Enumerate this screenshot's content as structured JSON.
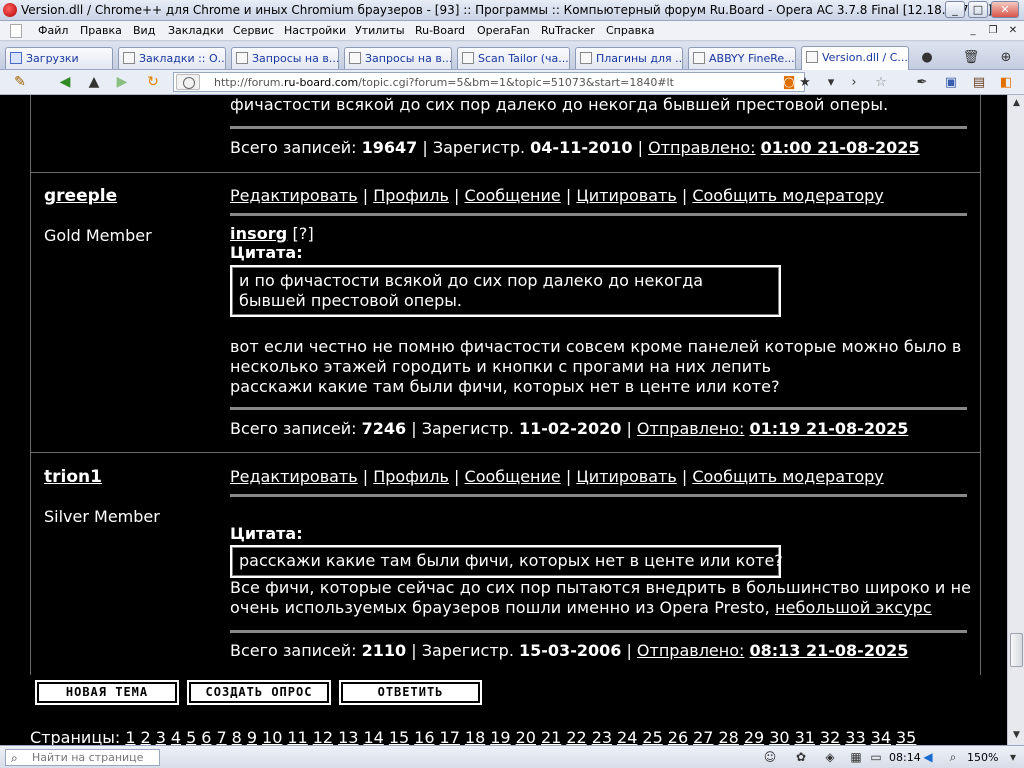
{
  "window": {
    "title": "Version.dll / Chrome++ для Chrome и иных Chromium браузеров - [93] :: Программы :: Компьютерный форум Ru.Board - Opera AC 3.7.8 Final [12.18.1872.5]",
    "minimize": "_",
    "restore": "□",
    "close": "✕"
  },
  "menu": {
    "items": [
      "Файл",
      "Правка",
      "Вид",
      "Закладки",
      "Сервис",
      "Настройки",
      "Утилиты",
      "Ru-Board",
      "OperaFan",
      "RuTracker",
      "Справка"
    ],
    "mdi_minimize": "_",
    "mdi_restore": "❐",
    "mdi_close": "✕"
  },
  "tabs": [
    {
      "label": "Загрузки",
      "icon": "download-icon"
    },
    {
      "label": "Закладки :: О...",
      "icon": "page-icon"
    },
    {
      "label": "Запросы на в...",
      "icon": "page-icon"
    },
    {
      "label": "Запросы на в...",
      "icon": "page-icon"
    },
    {
      "label": "Scan Tailor (ча...",
      "icon": "page-icon"
    },
    {
      "label": "Плагины для ...",
      "icon": "page-icon"
    },
    {
      "label": "ABBYY FineRe...",
      "icon": "page-icon"
    },
    {
      "label": "Version.dll / C...",
      "icon": "page-icon"
    }
  ],
  "address": {
    "url_prefix": "http://forum.",
    "url_domain": "ru-board.com",
    "url_rest": "/topic.cgi?forum=5&bm=1&topic=51073&start=1840#lt"
  },
  "posts": [
    {
      "tail_text": "фичастости всякой до сих пор далеко до некогда бывшей престовой оперы.",
      "stats": {
        "posts_label": "Всего записей:",
        "posts": "19647",
        "reg_label": "Зарегистр.",
        "reg": "04-11-2010",
        "sent_label": "Отправлено:",
        "sent": "01:00 21-08-2025"
      }
    },
    {
      "author": "greeple",
      "rank": "Gold Member",
      "actions": [
        "Редактировать",
        "Профиль",
        "Сообщение",
        "Цитировать",
        "Сообщить модератору"
      ],
      "mention": "insorg",
      "mention_suffix": "[?]",
      "quote_label": "Цитата:",
      "quote_lines": [
        "и по фичастости всякой до сих пор далеко до некогда",
        "бывшей престовой оперы."
      ],
      "body_lines": [
        "вот если честно не помню фичастости совсем кроме панелей которые можно было в",
        "несколько этажей городить и кнопки с прогами на них лепить",
        "расскажи какие там были фичи, которых нет в центе или коте?"
      ],
      "stats": {
        "posts_label": "Всего записей:",
        "posts": "7246",
        "reg_label": "Зарегистр.",
        "reg": "11-02-2020",
        "sent_label": "Отправлено:",
        "sent": "01:19 21-08-2025"
      }
    },
    {
      "author": "trion1",
      "rank": "Silver Member",
      "actions": [
        "Редактировать",
        "Профиль",
        "Сообщение",
        "Цитировать",
        "Сообщить модератору"
      ],
      "quote_label": "Цитата:",
      "quote_lines": [
        "расскажи какие там были фичи, которых нет в центе или коте?"
      ],
      "body_lines": [
        "Все фичи, которые сейчас до сих пор пытаются внедрить в большинство широко и не",
        "очень используемых браузеров пошли именно из Opera Presto, "
      ],
      "body_link": "небольшой эксурс",
      "stats": {
        "posts_label": "Всего записей:",
        "posts": "2110",
        "reg_label": "Зарегистр.",
        "reg": "15-03-2006",
        "sent_label": "Отправлено:",
        "sent": "08:13 21-08-2025"
      }
    }
  ],
  "buttons": {
    "new_topic": "НОВАЯ ТЕМА",
    "create_poll": "СОЗДАТЬ ОПРОС",
    "reply": "ОТВЕТИТЬ"
  },
  "pagination": {
    "label": "Страницы:",
    "pages": [
      "1",
      "2",
      "3",
      "4",
      "5",
      "6",
      "7",
      "8",
      "9",
      "10",
      "11",
      "12",
      "13",
      "14",
      "15",
      "16",
      "17",
      "18",
      "19",
      "20",
      "21",
      "22",
      "23",
      "24",
      "25",
      "26",
      "27",
      "28",
      "29",
      "30",
      "31",
      "32",
      "33",
      "34",
      "35"
    ]
  },
  "statusbar": {
    "find_placeholder": "Найти на странице",
    "time": "08:14",
    "zoom": "150%"
  }
}
